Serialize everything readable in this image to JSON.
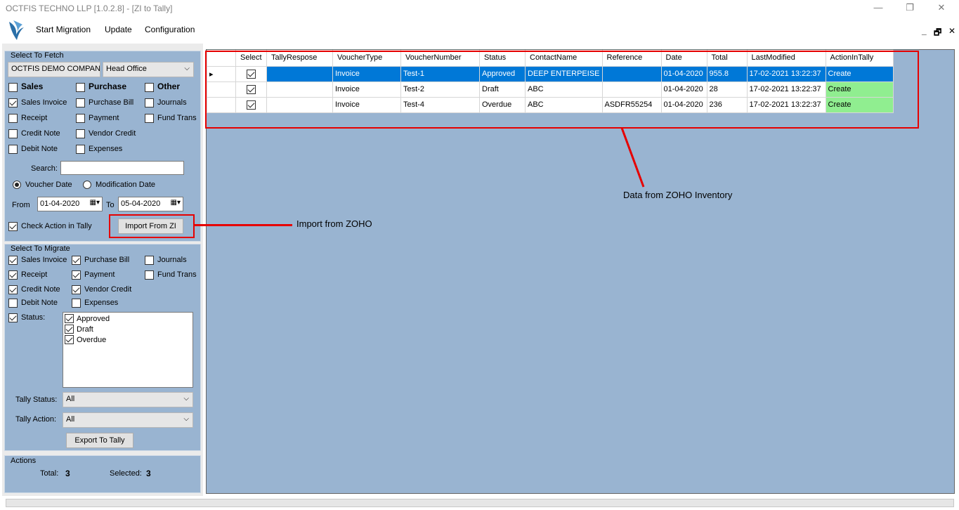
{
  "window": {
    "title": "OCTFIS TECHNO LLP [1.0.2.8] - [ZI to Tally]",
    "minimize": "—",
    "restore": "❐",
    "close": "✕"
  },
  "menu": {
    "items": [
      "Start Migration",
      "Update",
      "Configuration"
    ],
    "mdi_minimize": "_",
    "mdi_restore": "🗗",
    "mdi_close": "✕"
  },
  "fetch": {
    "title": "Select To Fetch",
    "company": "OCTFIS DEMO COMPANY",
    "branch": "Head Office",
    "categories": [
      {
        "label": "Sales",
        "checked": false
      },
      {
        "label": "Purchase",
        "checked": false
      },
      {
        "label": "Other",
        "checked": false
      }
    ],
    "options": [
      {
        "label": "Sales Invoice",
        "checked": true
      },
      {
        "label": "Purchase Bill",
        "checked": false
      },
      {
        "label": "Journals",
        "checked": false
      },
      {
        "label": "Receipt",
        "checked": false
      },
      {
        "label": "Payment",
        "checked": false
      },
      {
        "label": "Fund Trans",
        "checked": false
      },
      {
        "label": "Credit Note",
        "checked": false
      },
      {
        "label": "Vendor Credit",
        "checked": false
      },
      {
        "label": "Debit Note",
        "checked": false
      },
      {
        "label": "Expenses",
        "checked": false
      }
    ],
    "search_label": "Search:",
    "search_value": "",
    "radio_voucher": "Voucher Date",
    "radio_modification": "Modification Date",
    "from_label": "From",
    "from_date": "01-04-2020",
    "to_label": "To",
    "to_date": "05-04-2020",
    "check_action_label": "Check Action in Tally",
    "check_action_checked": true,
    "import_button": "Import From ZI"
  },
  "migrate": {
    "title": "Select To Migrate",
    "options": [
      {
        "label": "Sales Invoice",
        "checked": true
      },
      {
        "label": "Purchase Bill",
        "checked": true
      },
      {
        "label": "Journals",
        "checked": false
      },
      {
        "label": "Receipt",
        "checked": true
      },
      {
        "label": "Payment",
        "checked": true
      },
      {
        "label": "Fund Trans",
        "checked": false
      },
      {
        "label": "Credit Note",
        "checked": true
      },
      {
        "label": "Vendor Credit",
        "checked": true
      },
      {
        "label": "Debit Note",
        "checked": false
      },
      {
        "label": "Expenses",
        "checked": false
      }
    ],
    "status_label": "Status:",
    "status_checked": true,
    "status_items": [
      {
        "label": "Approved",
        "checked": true
      },
      {
        "label": "Draft",
        "checked": true
      },
      {
        "label": "Overdue",
        "checked": true
      }
    ],
    "tally_status_label": "Tally Status:",
    "tally_status_value": "All",
    "tally_action_label": "Tally Action:",
    "tally_action_value": "All",
    "export_button": "Export To Tally"
  },
  "actions": {
    "title": "Actions",
    "total_label": "Total:",
    "total_value": "3",
    "selected_label": "Selected:",
    "selected_value": "3"
  },
  "grid": {
    "columns": [
      "Select",
      "TallyRespose",
      "VoucherType",
      "VoucherNumber",
      "Status",
      "ContactName",
      "Reference",
      "Date",
      "Total",
      "LastModified",
      "ActionInTally"
    ],
    "rows": [
      {
        "selected": true,
        "tally_response": "",
        "voucher_type": "Invoice",
        "voucher_number": "Test-1",
        "status": "Approved",
        "contact": "DEEP ENTERPEISE",
        "reference": "",
        "date": "01-04-2020",
        "total": "955.8",
        "last_modified": "17-02-2021 13:22:37",
        "action": "Create"
      },
      {
        "selected": true,
        "tally_response": "",
        "voucher_type": "Invoice",
        "voucher_number": "Test-2",
        "status": "Draft",
        "contact": "ABC",
        "reference": "",
        "date": "01-04-2020",
        "total": "28",
        "last_modified": "17-02-2021 13:22:37",
        "action": "Create"
      },
      {
        "selected": true,
        "tally_response": "",
        "voucher_type": "Invoice",
        "voucher_number": "Test-4",
        "status": "Overdue",
        "contact": "ABC",
        "reference": "ASDFR55254",
        "date": "01-04-2020",
        "total": "236",
        "last_modified": "17-02-2021 13:22:37",
        "action": "Create"
      }
    ]
  },
  "annotations": {
    "data_from": "Data from ZOHO Inventory",
    "import_from": "Import from ZOHO"
  },
  "colors": {
    "panel_blue": "#99b4d1",
    "selection_blue": "#0078d7",
    "create_green": "#90ee90",
    "annotation_red": "#e60000"
  }
}
